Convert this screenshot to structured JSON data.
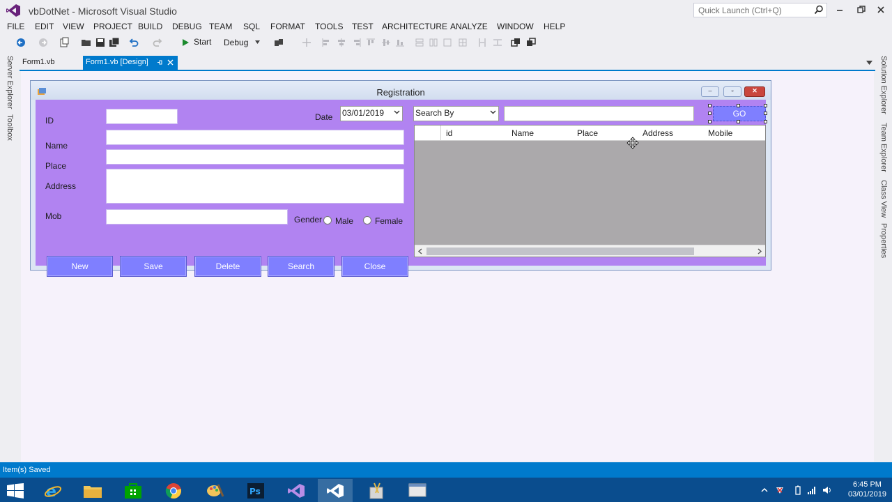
{
  "window": {
    "title": "vbDotNet - Microsoft Visual Studio",
    "quick_launch_placeholder": "Quick Launch (Ctrl+Q)"
  },
  "menu": [
    "FILE",
    "EDIT",
    "VIEW",
    "PROJECT",
    "BUILD",
    "DEBUG",
    "TEAM",
    "SQL",
    "FORMAT",
    "TOOLS",
    "TEST",
    "ARCHITECTURE",
    "ANALYZE",
    "WINDOW",
    "HELP"
  ],
  "toolbar": {
    "start_label": "Start",
    "config_value": "Debug"
  },
  "left_panels": [
    "Server Explorer",
    "Toolbox"
  ],
  "right_panels": [
    "Solution Explorer",
    "Team Explorer",
    "Class View",
    "Properties"
  ],
  "doc_tabs": [
    {
      "label": "Form1.vb",
      "active": false
    },
    {
      "label": "Form1.vb [Design]",
      "active": true
    }
  ],
  "form": {
    "title": "Registration",
    "labels": {
      "id": "ID",
      "name": "Name",
      "place": "Place",
      "address": "Address",
      "mob": "Mob",
      "date": "Date",
      "gender": "Gender",
      "male": "Male",
      "female": "Female"
    },
    "date_value": "03/01/2019",
    "buttons": [
      "New",
      "Save",
      "Delete",
      "Search",
      "Close"
    ],
    "search_by_value": "Search By",
    "go_label": "GO",
    "grid_columns": [
      "id",
      "Name",
      "Place",
      "Address",
      "Mobile"
    ]
  },
  "status": {
    "text": "Item(s) Saved"
  },
  "taskbar": {
    "time": "6:45 PM",
    "date": "03/01/2019"
  },
  "colors": {
    "accent": "#007acc",
    "form_back": "#b183f1",
    "button_back": "#7f7fff",
    "grid_back": "#aba9ab"
  }
}
